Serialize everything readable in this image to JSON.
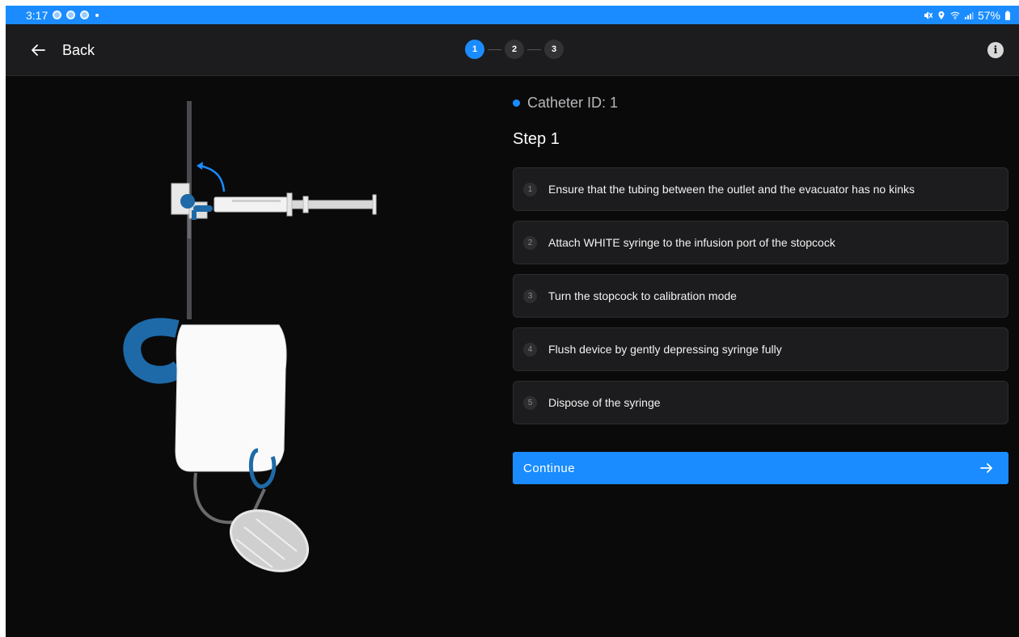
{
  "status_bar": {
    "time": "3:17",
    "battery": "57%",
    "icons": [
      "notification-icon",
      "notification-icon",
      "notification-icon",
      "mute-icon",
      "location-icon",
      "wifi-icon",
      "signal-icon",
      "battery-icon"
    ]
  },
  "header": {
    "back_label": "Back",
    "stepper": [
      {
        "label": "1",
        "state": "active"
      },
      {
        "label": "2",
        "state": "inactive"
      },
      {
        "label": "3",
        "state": "inactive"
      }
    ],
    "info_icon": "i"
  },
  "main": {
    "catheter_id": "Catheter ID: 1",
    "step_title": "Step 1",
    "steps": [
      {
        "number": "1",
        "text": "Ensure that the tubing between the outlet and the evacuator has no kinks"
      },
      {
        "number": "2",
        "text": "Attach WHITE syringe to the infusion port of the stopcock"
      },
      {
        "number": "3",
        "text": "Turn the stopcock to calibration mode"
      },
      {
        "number": "4",
        "text": "Flush device by gently depressing syringe fully"
      },
      {
        "number": "5",
        "text": "Dispose of the syringe"
      }
    ],
    "continue_label": "Continue"
  },
  "colors": {
    "accent": "#1a8cff",
    "background": "#0a0a0a",
    "card": "#1c1c1e",
    "device_blue": "#1e6aa8"
  }
}
